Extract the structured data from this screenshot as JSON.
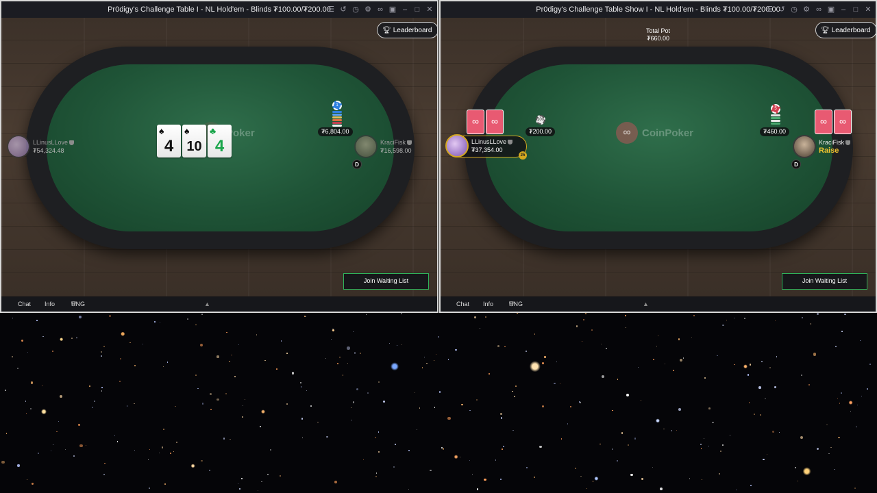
{
  "left_table": {
    "title": "Pr0digy's Challenge Table I - NL Hold'em - Blinds ₮100.00/₮200.00",
    "leaderboard_label": "Leaderboard",
    "watermark": "Poker",
    "board_cards": [
      {
        "rank": "4",
        "suit": "♠",
        "color": "black"
      },
      {
        "rank": "10",
        "suit": "♠",
        "color": "black"
      },
      {
        "rank": "4",
        "suit": "♣",
        "color": "green"
      }
    ],
    "pot_chip_number": "1",
    "pot_amount": "₮6,804.00",
    "players": {
      "left": {
        "name": "LLinusLLove",
        "stack": "₮54,324.48"
      },
      "right": {
        "name": "KraciFisk",
        "stack": "₮16,598.00"
      }
    },
    "dealer_label": "D",
    "join_label": "Join Waiting List",
    "bottom": {
      "chat": "Chat",
      "info": "Info",
      "rng": "RNG"
    }
  },
  "right_table": {
    "title": "Pr0digy's Challenge Table Show I - NL Hold'em - Blinds ₮100.00/₮200.00",
    "leaderboard_label": "Leaderboard",
    "total_pot_label": "Total Pot",
    "total_pot_amount": "₮660.00",
    "watermark": "CoinPoker",
    "players": {
      "left": {
        "name": "LLinusLLove",
        "stack": "₮37,354.00",
        "bet": "₮200.00",
        "bet_chip": "100",
        "timer": "25"
      },
      "right": {
        "name": "KraciFisk",
        "action": "Raise",
        "bet": "₮460.00",
        "bet_chip": "5"
      }
    },
    "dealer_label": "D",
    "join_label": "Join Waiting List",
    "bottom": {
      "chat": "Chat",
      "info": "Info",
      "rng": "RNG"
    }
  },
  "colors": {
    "felt": "#1f5437",
    "accent_green": "#2fb35a",
    "highlight": "#d4a81f",
    "card_back": "#e85a72"
  }
}
